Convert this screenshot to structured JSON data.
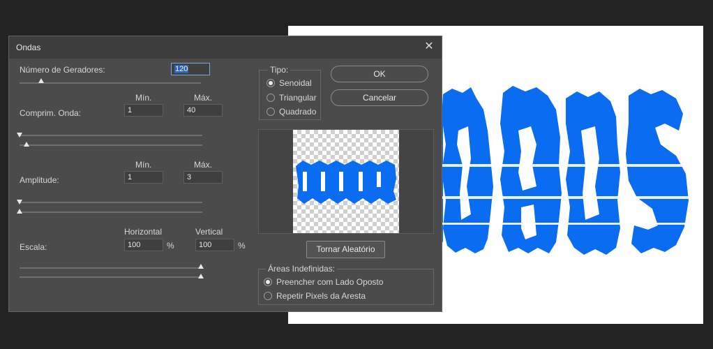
{
  "dialog": {
    "title": "Ondas",
    "generators": {
      "label": "Número de Geradores:",
      "value": "120",
      "slider_fraction": 0.12
    },
    "wavelength": {
      "label": "Comprim. Onda:",
      "min_header": "Mín.",
      "max_header": "Máx.",
      "min": "1",
      "max": "40"
    },
    "amplitude": {
      "label": "Amplitude:",
      "min_header": "Mín.",
      "max_header": "Máx.",
      "min": "1",
      "max": "3"
    },
    "scale": {
      "label": "Escala:",
      "h_header": "Horizontal",
      "v_header": "Vertical",
      "horizontal": "100",
      "vertical": "100",
      "unit": "%"
    },
    "type": {
      "legend": "Tipo:",
      "options": [
        "Senoidal",
        "Triangular",
        "Quadrado"
      ],
      "selected": 0
    },
    "buttons": {
      "ok": "OK",
      "cancel": "Cancelar",
      "randomize": "Tornar Aleatório"
    },
    "undefined_areas": {
      "legend": "Áreas Indefinidas:",
      "options": [
        "Preencher com Lado Oposto",
        "Repetir Pixels da Aresta"
      ],
      "selected": 0
    }
  },
  "colors": {
    "effect_blue": "#0a6cf0",
    "dialog_bg": "#4b4b4b"
  },
  "icons": {
    "close": "close-icon"
  }
}
